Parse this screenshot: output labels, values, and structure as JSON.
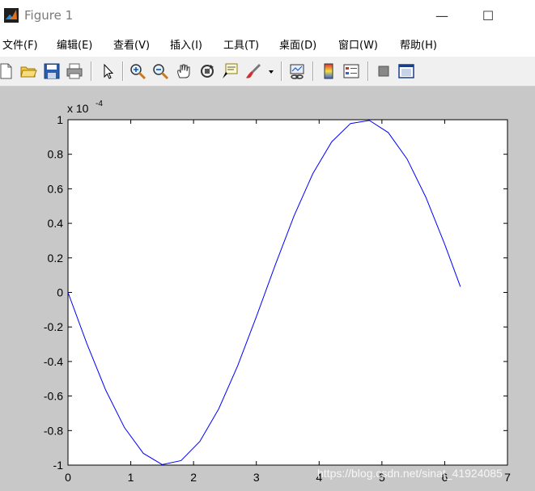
{
  "window": {
    "title": "Figure 1",
    "minimize_glyph": "—",
    "maximize_glyph": "☐",
    "app_icon": "matlab-icon"
  },
  "menu": {
    "items": [
      "文件(F)",
      "编辑(E)",
      "查看(V)",
      "插入(I)",
      "工具(T)",
      "桌面(D)",
      "窗口(W)",
      "帮助(H)"
    ]
  },
  "toolbar": {
    "icons": [
      "new-figure-icon",
      "open-file-icon",
      "save-icon",
      "print-icon",
      "select-arrow-icon",
      "zoom-in-icon",
      "zoom-out-icon",
      "pan-hand-icon",
      "rotate-3d-icon",
      "data-cursor-icon",
      "brush-icon",
      "dropdown-arrow-icon",
      "link-plot-icon",
      "colorbar-icon",
      "legend-icon",
      "hide-plot-tools-icon",
      "show-plot-tools-icon"
    ]
  },
  "chart_data": {
    "type": "line",
    "title": "",
    "xlabel": "",
    "ylabel": "",
    "xlim": [
      0,
      7
    ],
    "ylim": [
      -1,
      1
    ],
    "y_exponent_label": "x 10",
    "y_exponent_power": "-4",
    "x_ticks": [
      0,
      1,
      2,
      3,
      4,
      5,
      6,
      7
    ],
    "x_tick_labels": [
      "0",
      "1",
      "2",
      "3",
      "4",
      "5",
      "6",
      "7"
    ],
    "y_ticks": [
      -1,
      -0.8,
      -0.6,
      -0.4,
      -0.2,
      0,
      0.2,
      0.4,
      0.6,
      0.8,
      1
    ],
    "y_tick_labels": [
      "-1",
      "-0.8",
      "-0.6",
      "-0.4",
      "-0.2",
      "0",
      "0.2",
      "0.4",
      "0.6",
      "0.8",
      "1"
    ],
    "grid": false,
    "series": [
      {
        "color": "#0000ff",
        "x": [
          0,
          0.3,
          0.6,
          0.9,
          1.2,
          1.5,
          1.8,
          2.1,
          2.4,
          2.7,
          3.0,
          3.3,
          3.6,
          3.9,
          4.2,
          4.5,
          4.8,
          5.1,
          5.4,
          5.7,
          6.0,
          6.25
        ],
        "y": [
          0,
          -0.296,
          -0.565,
          -0.783,
          -0.932,
          -0.997,
          -0.974,
          -0.863,
          -0.675,
          -0.427,
          -0.141,
          0.158,
          0.443,
          0.688,
          0.872,
          0.978,
          0.996,
          0.926,
          0.773,
          0.551,
          0.279,
          0.033
        ]
      }
    ]
  },
  "watermark": {
    "text": "https://blog.csdn.net/sinat_41924085"
  }
}
